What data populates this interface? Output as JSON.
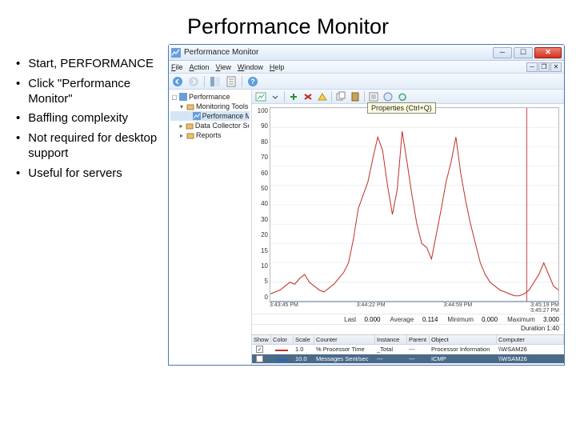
{
  "slide": {
    "title": "Performance Monitor",
    "bullets": [
      "Start, PERFORMANCE",
      "Click \"Performance Monitor\"",
      "Baffling complexity",
      "Not required for desktop support",
      "Useful for servers"
    ]
  },
  "window": {
    "title": "Performance Monitor",
    "menus": [
      "File",
      "Action",
      "View",
      "Window",
      "Help"
    ],
    "tree": {
      "root": "Performance",
      "items": [
        {
          "label": "Monitoring Tools",
          "expanded": true
        },
        {
          "label": "Performance Monitor",
          "selected": true,
          "child": true
        },
        {
          "label": "Data Collector Sets",
          "expanded": false
        },
        {
          "label": "Reports",
          "expanded": false
        }
      ]
    },
    "tooltip": "Properties (Ctrl+Q)",
    "chart_data": {
      "type": "line",
      "ylim": [
        0,
        100
      ],
      "yticks": [
        100,
        90,
        80,
        70,
        60,
        50,
        40,
        30,
        20,
        15,
        10,
        5,
        0
      ],
      "x_labels_left": "3:43:45 PM",
      "x_labels_mid1": "3:44:22 PM",
      "x_labels_mid2": "3:44:59 PM",
      "x_labels_right1": "3:45:19 PM",
      "x_labels_right2": "3:45:27 PM",
      "series": [
        {
          "name": "% Processor Time",
          "color": "#c03028",
          "values": [
            4,
            5,
            6,
            8,
            10,
            9,
            12,
            14,
            10,
            8,
            6,
            5,
            7,
            9,
            12,
            15,
            20,
            32,
            48,
            55,
            62,
            74,
            85,
            78,
            60,
            45,
            58,
            88,
            72,
            55,
            40,
            30,
            28,
            22,
            35,
            48,
            62,
            72,
            85,
            66,
            52,
            40,
            30,
            20,
            14,
            10,
            8,
            6,
            5,
            4,
            3,
            3,
            4,
            6,
            10,
            14,
            20,
            14,
            8,
            6
          ]
        },
        {
          "name": "Messages Sent/sec",
          "color": "#2a60c8",
          "values": [
            0,
            0,
            0,
            0,
            0,
            0,
            0,
            0,
            0,
            0,
            0,
            0,
            0,
            0,
            0,
            0,
            0,
            0,
            0,
            0,
            0,
            0,
            0,
            0,
            0,
            0,
            0,
            0,
            0,
            0,
            0,
            0,
            0,
            0,
            0,
            0,
            0,
            0,
            0,
            0,
            0,
            0,
            0,
            0,
            0,
            0,
            0,
            0,
            0,
            0,
            0,
            0,
            0,
            0,
            0,
            0,
            0,
            0,
            0,
            0
          ]
        }
      ]
    },
    "stats": {
      "last_label": "Last",
      "last": "0.000",
      "avg_label": "Average",
      "avg": "0.114",
      "min_label": "Minimum",
      "min": "0.000",
      "max_label": "Maximum",
      "max": "3.000",
      "dur_label": "Duration",
      "dur": "1:40"
    },
    "counter_table": {
      "headers": [
        "Show",
        "Color",
        "Scale",
        "Counter",
        "Instance",
        "Parent",
        "Object",
        "Computer"
      ],
      "rows": [
        {
          "show": true,
          "color": "#c03028",
          "scale": "1.0",
          "counter": "% Processor Time",
          "instance": "_Total",
          "parent": "---",
          "object": "Processor Information",
          "computer": "\\\\WSAM26"
        },
        {
          "show": true,
          "color": "#2a60c8",
          "scale": "10.0",
          "counter": "Messages Sent/sec",
          "instance": "---",
          "parent": "---",
          "object": "ICMP",
          "computer": "\\\\WSAM26",
          "hl": true
        }
      ]
    }
  }
}
